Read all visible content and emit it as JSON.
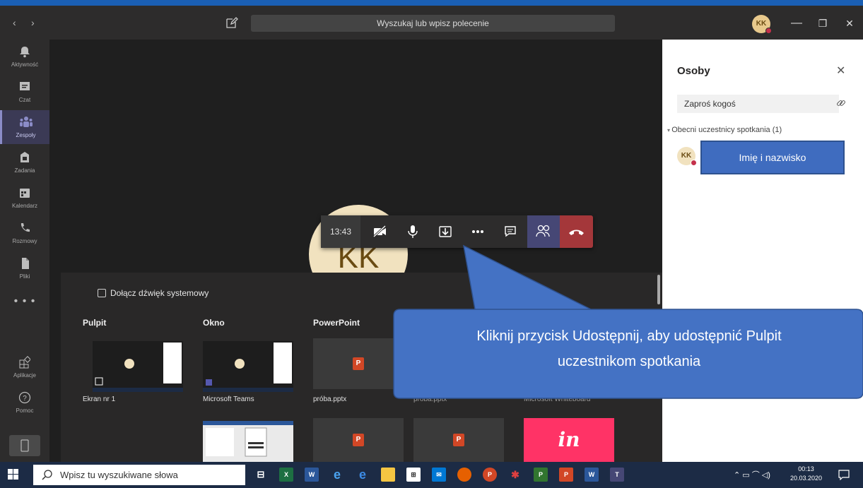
{
  "titlebar": {
    "back": "‹",
    "forward": "›",
    "search_placeholder": "Wyszukaj lub wpisz polecenie",
    "user_initials": "KK",
    "minimize": "—",
    "maximize": "❐",
    "close": "✕"
  },
  "rail": {
    "items": [
      {
        "label": "Aktywność",
        "icon": "bell-icon"
      },
      {
        "label": "Czat",
        "icon": "chat-icon"
      },
      {
        "label": "Zespoły",
        "icon": "teams-icon"
      },
      {
        "label": "Zadania",
        "icon": "assignments-icon"
      },
      {
        "label": "Kalendarz",
        "icon": "calendar-icon"
      },
      {
        "label": "Rozmowy",
        "icon": "phone-icon"
      },
      {
        "label": "Pliki",
        "icon": "files-icon"
      }
    ],
    "more": "• • •",
    "apps": "Aplikacje",
    "help": "Pomoc",
    "active": "Zespoły"
  },
  "meeting": {
    "avatar_initials": "KK",
    "timer": "13:43"
  },
  "share_tray": {
    "system_audio_label": "Dołącz dźwięk systemowy",
    "columns": [
      "Pulpit",
      "Okno",
      "PowerPoint"
    ],
    "captions": [
      "Ekran nr 1",
      "Microsoft Teams",
      "próba.pptx",
      "próba.pptx",
      "Microsoft Whiteboard"
    ],
    "invision_text": "in"
  },
  "people_panel": {
    "title": "Osoby",
    "close": "✕",
    "invite_placeholder": "Zaproś kogoś",
    "section_label": "Obecni uczestnicy spotkania (1)",
    "participant_initials": "KK",
    "participant_name": "Imię i nazwisko"
  },
  "callout": {
    "line1": "Kliknij przycisk Udostępnij, aby udostępnić Pulpit",
    "line2": "uczestnikom spotkania"
  },
  "taskbar": {
    "search_placeholder": "Wpisz tu wyszukiwane słowa",
    "time": "00:13",
    "date": "20.03.2020"
  },
  "colors": {
    "accent": "#464775",
    "hangup": "#a4373a",
    "callout": "#3f6cbf",
    "presence_busy": "#c4314b"
  }
}
